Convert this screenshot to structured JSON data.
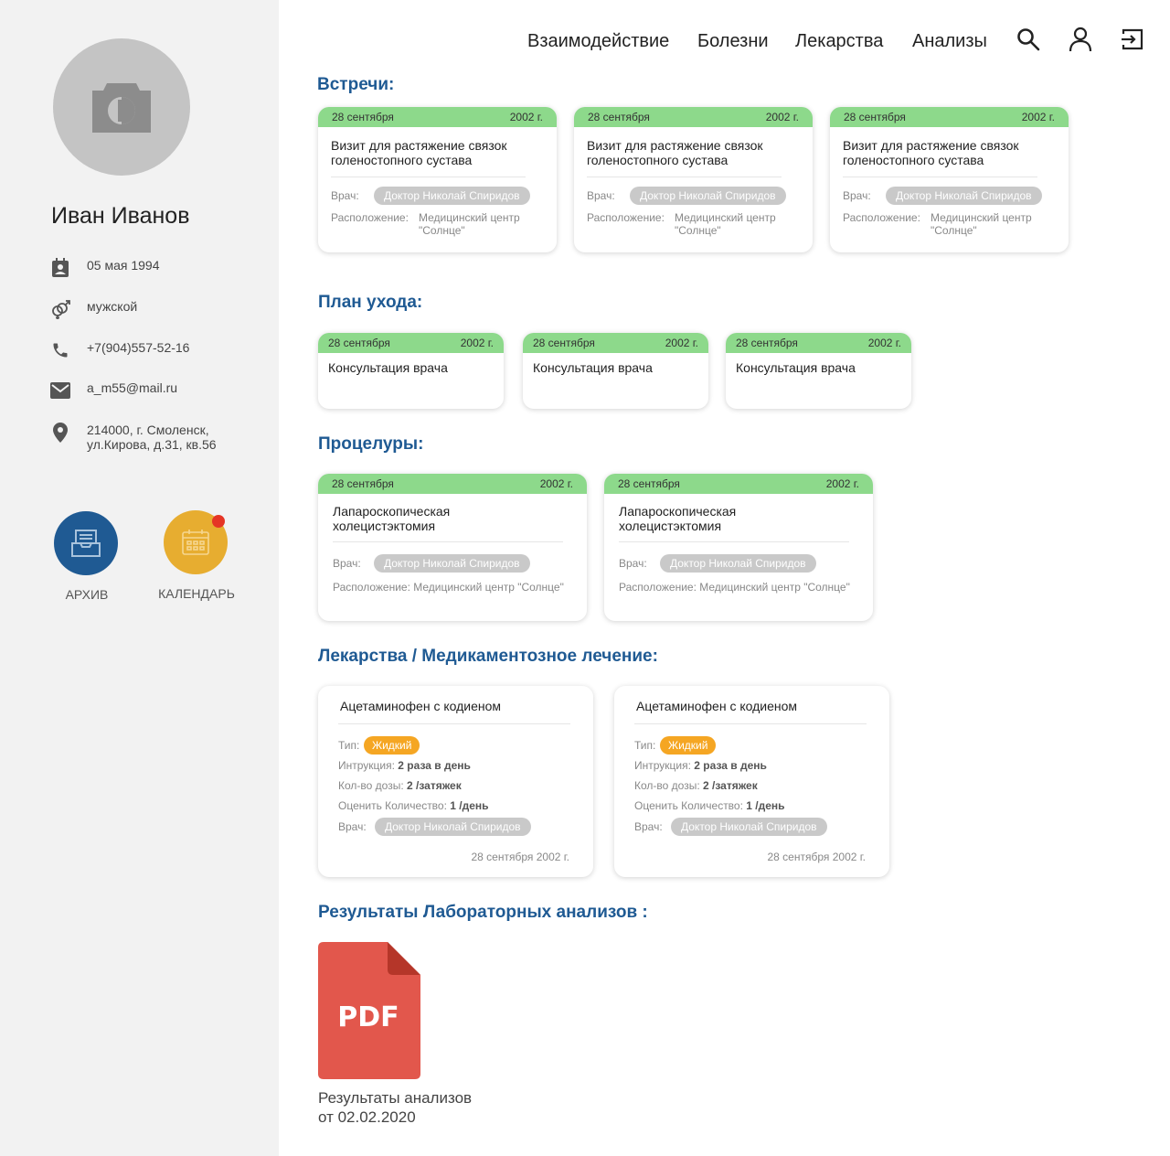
{
  "user": {
    "name": "Иван Иванов",
    "birthdate": "05 мая 1994",
    "gender": "мужской",
    "phone": "+7(904)557-52-16",
    "email": "a_m55@mail.ru",
    "address_line1": "214000, г. Смоленск,",
    "address_line2": "ул.Кирова, д.31, кв.56"
  },
  "sidebar_buttons": {
    "archive": "АРХИВ",
    "calendar": "КАЛЕНДАРЬ"
  },
  "nav": {
    "interaction": "Взаимодействие",
    "diseases": "Болезни",
    "medicines": "Лекарства",
    "analyses": "Анализы"
  },
  "sections": {
    "meetings": "Встречи:",
    "care_plan": "План ухода:",
    "procedures": "Процелуры:",
    "medication": "Лекарства / Медикаментозное лечение:",
    "lab_results": "Результаты Лабораторных анализов :"
  },
  "meetings": [
    {
      "date": "28 сентября",
      "year": "2002 г.",
      "title_line1": "Визит для растяжение связок",
      "title_line2": "голеностопного сустава",
      "doctor_label": "Врач:",
      "doctor": "Доктор Николай Спиридов",
      "location_label": "Расположение:",
      "location_line1": "Медицинский центр",
      "location_line2": "\"Солнце\""
    },
    {
      "date": "28 сентября",
      "year": "2002 г.",
      "title_line1": "Визит для растяжение связок",
      "title_line2": "голеностопного сустава",
      "doctor_label": "Врач:",
      "doctor": "Доктор Николай Спиридов",
      "location_label": "Расположение:",
      "location_line1": "Медицинский центр",
      "location_line2": "\"Солнце\""
    },
    {
      "date": "28 сентября",
      "year": "2002 г.",
      "title_line1": "Визит для растяжение связок",
      "title_line2": "голеностопного сустава",
      "doctor_label": "Врач:",
      "doctor": "Доктор Николай Спиридов",
      "location_label": "Расположение:",
      "location_line1": "Медицинский центр",
      "location_line2": "\"Солнце\""
    }
  ],
  "care_plan": [
    {
      "date": "28 сентября",
      "year": "2002 г.",
      "title": "Консультация врача"
    },
    {
      "date": "28 сентября",
      "year": "2002 г.",
      "title": "Консультация врача"
    },
    {
      "date": "28 сентября",
      "year": "2002 г.",
      "title": "Консультация врача"
    }
  ],
  "procedures": [
    {
      "date": "28 сентября",
      "year": "2002 г.",
      "title_line1": "Лапароскопическая",
      "title_line2": "холецистэктомия",
      "doctor_label": "Врач:",
      "doctor": "Доктор Николай Спиридов",
      "location": "Расположение: Медицинский центр \"Солнце\""
    },
    {
      "date": "28 сентября",
      "year": "2002 г.",
      "title_line1": "Лапароскопическая",
      "title_line2": "холецистэктомия",
      "doctor_label": "Врач:",
      "doctor": "Доктор Николай Спиридов",
      "location": "Расположение: Медицинский центр \"Солнце\""
    }
  ],
  "medications": [
    {
      "name": "Ацетаминофен с кодиеном",
      "type_label": "Тип:",
      "type": "Жидкий",
      "instruction_label": "Интрукция:",
      "instruction": "2 раза в  день",
      "dose_label": "Кол-во дозы:",
      "dose": "2 /затяжек",
      "amount_label": "Оценить Количество:",
      "amount": "1 /день",
      "doctor_label": "Врач:",
      "doctor": "Доктор Николай Спиридов",
      "date": "28 сентября 2002 г."
    },
    {
      "name": "Ацетаминофен с кодиеном",
      "type_label": "Тип:",
      "type": "Жидкий",
      "instruction_label": "Интрукция:",
      "instruction": "2 раза в  день",
      "dose_label": "Кол-во дозы:",
      "dose": "2 /затяжек",
      "amount_label": "Оценить Количество:",
      "amount": "1 /день",
      "doctor_label": "Врач:",
      "doctor": "Доктор Николай Спиридов",
      "date": "28 сентября 2002 г."
    }
  ],
  "lab_file": {
    "badge": "PDF",
    "label_line1": "Результаты анализов",
    "label_line2": "от 02.02.2020"
  },
  "colors": {
    "accent_blue": "#1f5a93",
    "card_header_green": "#8dd98b",
    "archive_blue": "#1f5a93",
    "calendar_yellow": "#e7ad30",
    "pdf_red": "#e2574c",
    "chip_orange": "#f5a623"
  },
  "icons": [
    "camera-icon",
    "calendar-contact-icon",
    "gender-icon",
    "phone-icon",
    "mail-icon",
    "location-pin-icon",
    "archive-icon",
    "calendar-icon",
    "search-icon",
    "user-icon",
    "logout-icon",
    "pdf-file-icon"
  ]
}
